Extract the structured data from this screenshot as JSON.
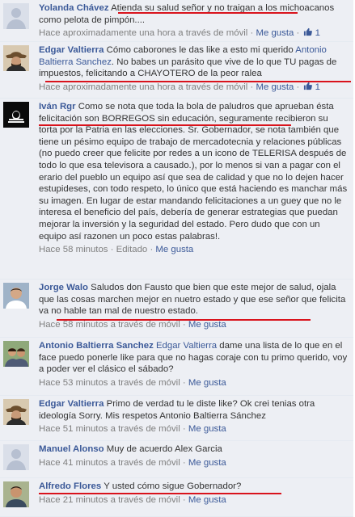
{
  "comments": [
    {
      "author": "Yolanda Chávez",
      "text_a": "Atienda su salud señor y no traigan a los",
      "text_b": "michoacanos como pelota de pimpón....",
      "time": "Hace aproximadamente una hora a través de móvil",
      "like": "Me gusta",
      "likes": "1"
    },
    {
      "author": "Edgar Valtierra",
      "pre": "Cómo caborones le das like a esto mi querido",
      "mention": "Antonio Baltierra Sanchez",
      "text": ". No babes un parásito que vive de lo que TU pagas de impuestos, felicitando a CHAYOTERO de la peor ralea",
      "time": "Hace aproximadamente una hora a través de móvil",
      "like": "Me gusta",
      "likes": "1"
    },
    {
      "author": "Iván Rgr",
      "text": "Como se nota que toda la bola de paludros que aprueban ésta felicitación son BORREGOS sin educación, seguramente recibieron su torta por la Patria en las elecciones. Sr. Gobernador, se nota también que tiene un pésimo equipo de trabajo de mercadotecnia y relaciones públicas (no puedo creer que felicite por redes a un icono de TELERISA después de todo lo que esa televisora a causado.), por lo menos si van a pagar con el erario del pueblo un equipo así que sea de calidad y que no lo dejen hacer estupideses, con todo respeto, lo único que está haciendo es manchar más su imagen. En lugar de estar mandando felicitaciones a un guey que no le interesa el beneficio del país, debería de generar estrategias que puedan mejorar la inversión y la seguridad del estado. Pero dudo que con un equipo así razonen un poco estas palabras!.",
      "time": "Hace 58 minutos",
      "edited": "Editado",
      "like": "Me gusta"
    },
    {
      "author": "Jorge Walo",
      "text": "Saludos don Fausto que bien que este mejor de salud, ojala que las cosas marchen mejor en nuetro estado y que ese señor que felicita va no hable tan mal de nuestro estado.",
      "time": "Hace 58 minutos a través de móvil",
      "like": "Me gusta"
    },
    {
      "author": "Antonio Baltierra Sanchez",
      "mention": "Edgar Valtierra",
      "text": "dame una lista de lo que en el face puedo ponerle like para que no hagas coraje con tu primo querido, voy a poder ver el clásico el sábado?",
      "time": "Hace 53 minutos a través de móvil",
      "like": "Me gusta"
    },
    {
      "author": "Edgar Valtierra",
      "text": "Primo de verdad tu le diste like? Ok crei tenias otra ideología Sorry. Mis respetos Antonio Baltierra Sánchez",
      "time": "Hace 51 minutos a través de móvil",
      "like": "Me gusta"
    },
    {
      "author": "Manuel Alonso",
      "text": "Muy de acuerdo Alex Garcia",
      "time": "Hace 41 minutos a través de móvil",
      "like": "Me gusta"
    },
    {
      "author": "Alfredo Flores",
      "text": "Y usted cómo sigue Gobernador?",
      "time": "Hace 21 minutos a través de móvil",
      "like": "Me gusta"
    }
  ],
  "separator": "·",
  "icons": {
    "like": "thumbs-up-icon"
  },
  "colors": {
    "link": "#3b5998",
    "meta": "#7f7f7f",
    "background": "#edeff4",
    "annotation": "#d9131c"
  }
}
